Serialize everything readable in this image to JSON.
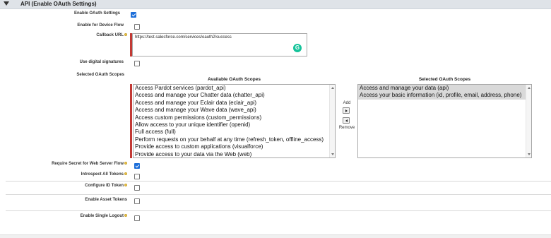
{
  "section": {
    "title": "API (Enable OAuth Settings)"
  },
  "fields": {
    "enable_oauth": {
      "label": "Enable OAuth Settings",
      "checked": true
    },
    "device_flow": {
      "label": "Enable for Device Flow",
      "checked": false
    },
    "callback_url": {
      "label": "Callback URL",
      "value": "https://test.salesforce.com/services/oauth2/success"
    },
    "digital_signatures": {
      "label": "Use digital signatures",
      "checked": false
    },
    "selected_scopes_label": "Selected OAuth Scopes",
    "require_secret": {
      "label": "Require Secret for Web Server Flow",
      "checked": true
    },
    "introspect_tokens": {
      "label": "Introspect All Tokens",
      "checked": false
    },
    "configure_id_token": {
      "label": "Configure ID Token",
      "checked": false
    },
    "enable_asset_tokens": {
      "label": "Enable Asset Tokens",
      "checked": false
    },
    "enable_single_logout": {
      "label": "Enable Single Logout",
      "checked": false
    }
  },
  "scopes": {
    "available_title": "Available OAuth Scopes",
    "selected_title": "Selected OAuth Scopes",
    "available": [
      "Access Pardot services (pardot_api)",
      "Access and manage your Chatter data (chatter_api)",
      "Access and manage your Eclair data (eclair_api)",
      "Access and manage your Wave data (wave_api)",
      "Access custom permissions (custom_permissions)",
      "Allow access to your unique identifier (openid)",
      "Full access (full)",
      "Perform requests on your behalf at any time (refresh_token, offline_access)",
      "Provide access to custom applications (visualforce)",
      "Provide access to your data via the Web (web)"
    ],
    "selected": [
      "Access and manage your data (api)",
      "Access your basic information (id, profile, email, address, phone)"
    ],
    "add_label": "Add",
    "remove_label": "Remove"
  },
  "colors": {
    "required": "#c23934",
    "checkbox_checked": "#1e6fd9",
    "grammarly": "#15c39a"
  }
}
